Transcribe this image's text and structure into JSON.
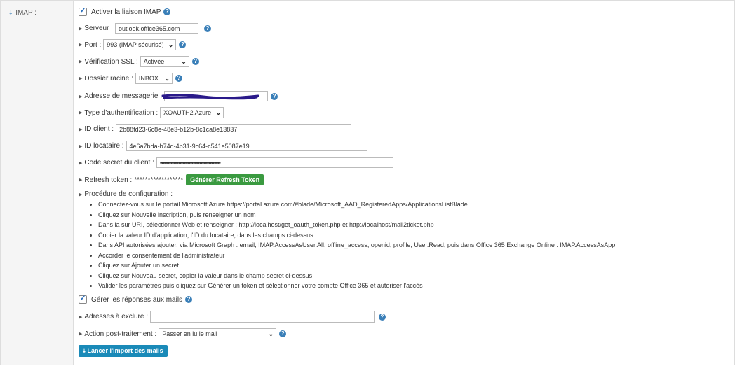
{
  "section": {
    "title": "IMAP :"
  },
  "imap_enable": {
    "label": "Activer la liaison IMAP",
    "checked": true
  },
  "server": {
    "label": "Serveur :",
    "value": "outlook.office365.com"
  },
  "port": {
    "label": "Port :",
    "value": "993 (IMAP sécurisé)"
  },
  "ssl": {
    "label": "Vérification SSL :",
    "value": "Activée"
  },
  "root_folder": {
    "label": "Dossier racine :",
    "value": "INBOX"
  },
  "email": {
    "label": "Adresse de messagerie :",
    "value": ""
  },
  "auth_type": {
    "label": "Type d'authentification :",
    "value": "XOAUTH2 Azure"
  },
  "client_id": {
    "label": "ID client :",
    "value": "2b88fd23-6c8e-48e3-b12b-8c1ca8e13837"
  },
  "tenant_id": {
    "label": "ID locataire :",
    "value": "4e6a7bda-b74d-4b31-9c64-c541e5087e19"
  },
  "client_secret": {
    "label": "Code secret du client :",
    "value": "••••••••••••••••••••••••••••••••••••••••"
  },
  "refresh_token": {
    "label": "Refresh token :",
    "value": "******************",
    "button": "Générer Refresh Token"
  },
  "procedure": {
    "label": "Procédure de configuration :",
    "steps": [
      "Connectez-vous sur le portail Microsoft Azure https://portal.azure.com/#blade/Microsoft_AAD_RegisteredApps/ApplicationsListBlade",
      "Cliquez sur Nouvelle inscription, puis renseigner un nom",
      "Dans la sur URI, sélectionner Web et renseigner : http://localhost/get_oauth_token.php et http://localhost/mail2ticket.php",
      "Copier la valeur ID d'application, l'ID du locataire, dans les champs ci-dessus",
      "Dans API autorisées ajouter, via Microsoft Graph : email, IMAP.AccessAsUser.All, offline_access, openid, profile, User.Read, puis dans Office 365 Exchange Online : IMAP.AccessAsApp",
      "Accorder le consentement de l'administrateur",
      "Cliquez sur Ajouter un secret",
      "Cliquez sur Nouveau secret, copier la valeur dans le champ secret ci-dessus",
      "Valider les paramètres puis cliquez sur Générer un token et sélectionner votre compte Office 365 et autoriser l'accès"
    ]
  },
  "replies": {
    "label": "Gérer les réponses aux mails",
    "checked": true
  },
  "exclude": {
    "label": "Adresses à exclure :",
    "value": ""
  },
  "post_action": {
    "label": "Action post-traitement :",
    "value": "Passer en lu le mail"
  },
  "import_button": {
    "label": "Lancer l'import des mails"
  },
  "help_glyph": "?",
  "colors": {
    "accent": "#3a7fb8",
    "green": "#3a9a40",
    "import": "#1a8ab8",
    "redaction": "#2a1a8a"
  }
}
